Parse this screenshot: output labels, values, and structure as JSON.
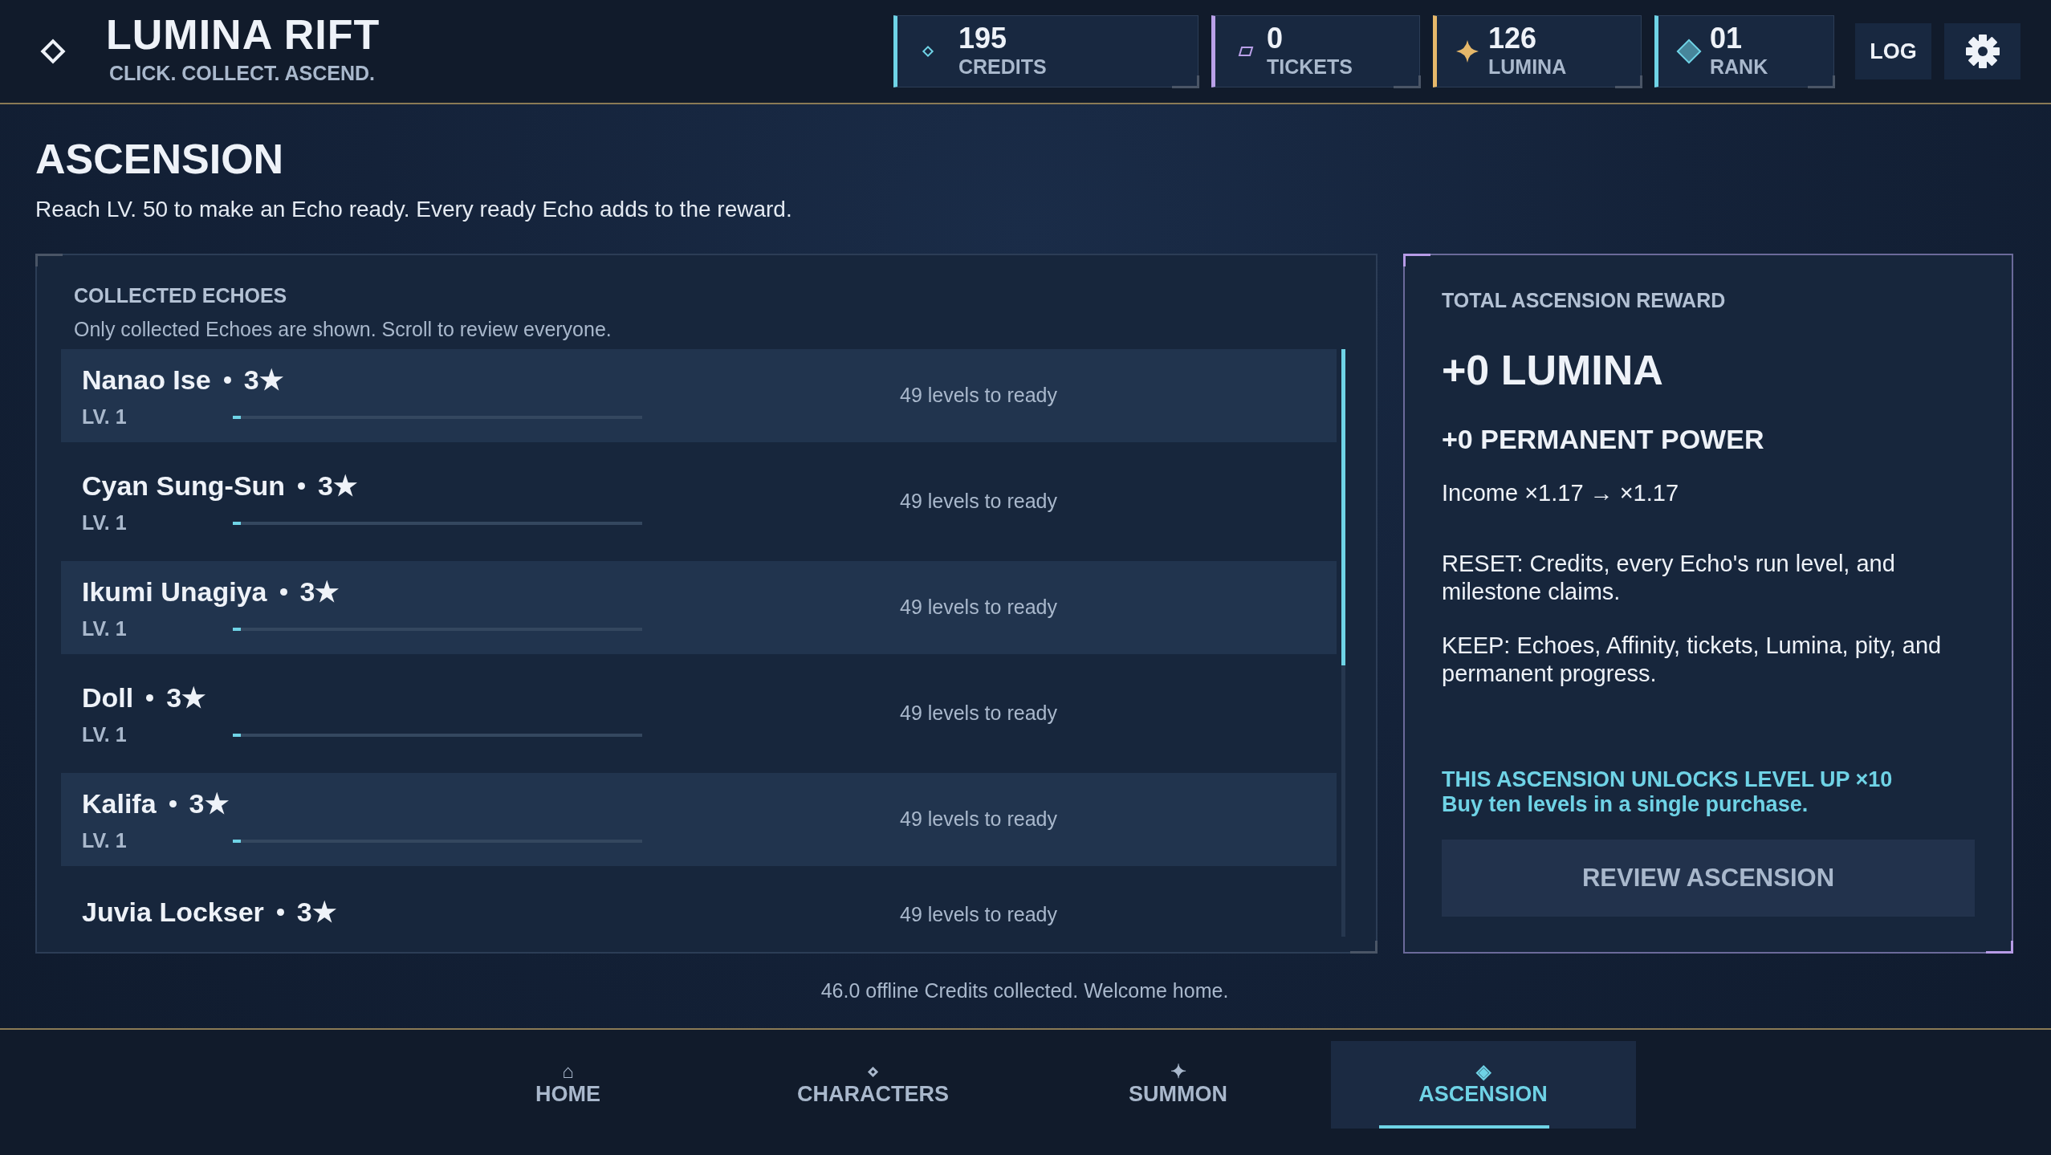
{
  "app": {
    "title": "LUMINA RIFT",
    "tagline": "CLICK. COLLECT. ASCEND."
  },
  "stats": [
    {
      "kind": "credits",
      "value": "195",
      "label": "CREDITS",
      "color": "#6fd3e6"
    },
    {
      "kind": "tickets",
      "value": "0",
      "label": "TICKETS",
      "color": "#b9a0e8"
    },
    {
      "kind": "lumina",
      "value": "126",
      "label": "LUMINA",
      "color": "#e6b86a"
    },
    {
      "kind": "rank",
      "value": "01",
      "label": "RANK",
      "color": "#6fd3e6"
    }
  ],
  "toolbar": [
    {
      "kind": "text",
      "label": "LOG"
    },
    {
      "kind": "settings"
    }
  ],
  "page": {
    "title": "ASCENSION",
    "subtitle": "Reach LV. 50 to make an Echo ready. Every ready Echo adds to the reward."
  },
  "echoes_panel": {
    "heading": "COLLECTED ECHOES",
    "note": "Only collected Echoes are shown. Scroll to review everyone.",
    "echoes": [
      {
        "name": "Nanao Ise",
        "rarity": "3★",
        "level_label": "LV. 1",
        "level": 0.02,
        "reading": "49 levels to ready"
      },
      {
        "name": "Cyan Sung-Sun",
        "rarity": "3★",
        "level_label": "LV. 1",
        "level": 0.02,
        "reading": "49 levels to ready"
      },
      {
        "name": "Ikumi Unagiya",
        "rarity": "3★",
        "level_label": "LV. 1",
        "level": 0.02,
        "reading": "49 levels to ready"
      },
      {
        "name": "Doll",
        "rarity": "3★",
        "level_label": "LV. 1",
        "level": 0.02,
        "reading": "49 levels to ready"
      },
      {
        "name": "Kalifa",
        "rarity": "3★",
        "level_label": "LV. 1",
        "level": 0.02,
        "reading": "49 levels to ready"
      },
      {
        "name": "Juvia Lockser",
        "rarity": "3★",
        "reading": "49 levels to ready"
      }
    ]
  },
  "reward_panel": {
    "heading": "TOTAL ASCENSION REWARD",
    "amount": "+0 LUMINA",
    "power": "+0 PERMANENT POWER",
    "income": "Income ×1.17 → ×1.17",
    "notes": [
      "RESET: Credits, every Echo's run level, and milestone claims.",
      "KEEP: Echoes, Affinity, tickets, Lumina, pity, and permanent progress."
    ],
    "unlock_title": "THIS ASCENSION UNLOCKS LEVEL UP ×10",
    "unlock_text": "Buy ten levels in a single purchase.",
    "button": "REVIEW ASCENSION"
  },
  "status_message": "46.0 offline Credits collected. Welcome home.",
  "nav": [
    {
      "icon": "⌂",
      "label": "HOME",
      "selected": false
    },
    {
      "icon": "⋄",
      "label": "CHARACTERS",
      "selected": false
    },
    {
      "icon": "✦",
      "label": "SUMMON",
      "selected": false
    },
    {
      "icon": "◈",
      "label": "ASCENSION",
      "selected": true
    }
  ]
}
